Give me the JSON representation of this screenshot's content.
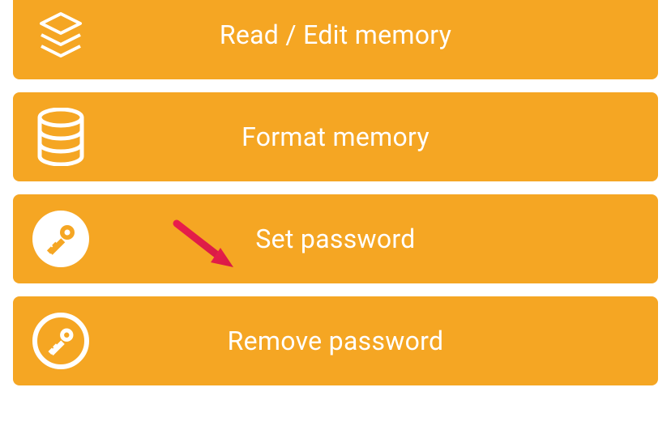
{
  "menu": {
    "items": [
      {
        "label": ""
      },
      {
        "label": "Read / Edit memory"
      },
      {
        "label": "Format memory"
      },
      {
        "label": "Set password"
      },
      {
        "label": "Remove password"
      }
    ]
  },
  "colors": {
    "accent": "#f5a623",
    "arrow": "#e91e4c"
  }
}
